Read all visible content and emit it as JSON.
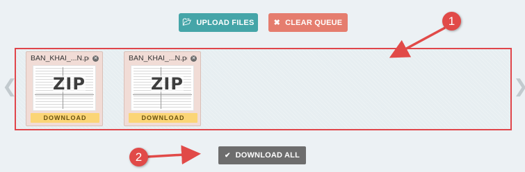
{
  "toolbar": {
    "upload_label": "UPLOAD FILES",
    "upload_icon": "folder-open-icon",
    "clear_label": "CLEAR QUEUE",
    "clear_icon": "close-icon"
  },
  "files": [
    {
      "name": "BAN_KHAI_...N.pd",
      "thumb_text": "ZIP",
      "download_label": "DOWNLOAD"
    },
    {
      "name": "BAN_KHAI_...N.pd",
      "thumb_text": "ZIP",
      "download_label": "DOWNLOAD"
    }
  ],
  "download_all": {
    "label": "DOWNLOAD ALL",
    "icon": "check-icon"
  },
  "annotations": [
    "1",
    "2"
  ],
  "colors": {
    "upload_button": "#45a5a8",
    "clear_button": "#e57d6e",
    "download_all_button": "#6d6d6d",
    "queue_border": "#e0454a",
    "download_button": "#fbd576",
    "annotation": "#e14a48"
  }
}
